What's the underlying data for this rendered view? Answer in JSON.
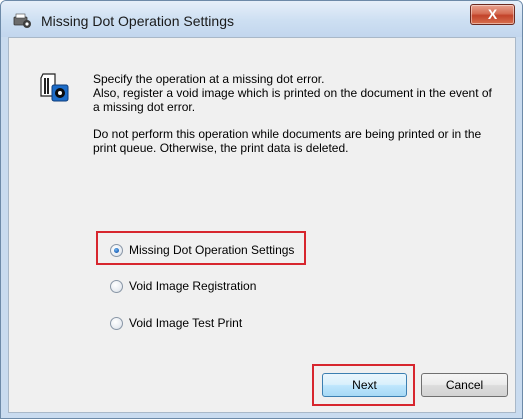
{
  "window": {
    "title": "Missing Dot Operation Settings",
    "close_label": "X"
  },
  "content": {
    "paragraph1": "Specify the operation at a missing dot error.\nAlso, register a void image which is printed on the document in the event of\na missing dot error.",
    "paragraph2": "Do not perform this operation while documents are being printed or in the\nprint queue. Otherwise, the print data is deleted."
  },
  "options": [
    {
      "label": "Missing Dot Operation Settings",
      "selected": true
    },
    {
      "label": "Void Image Registration",
      "selected": false
    },
    {
      "label": "Void Image Test Print",
      "selected": false
    }
  ],
  "buttons": {
    "next_label": "Next",
    "cancel_label": "Cancel"
  },
  "colors": {
    "highlight": "#d7262e",
    "titlebar": "#cddff2",
    "client_bg": "#f0f0f0"
  },
  "icons": {
    "app": "printer-gear-icon",
    "doc": "document-gear-icon",
    "close": "close-icon"
  }
}
